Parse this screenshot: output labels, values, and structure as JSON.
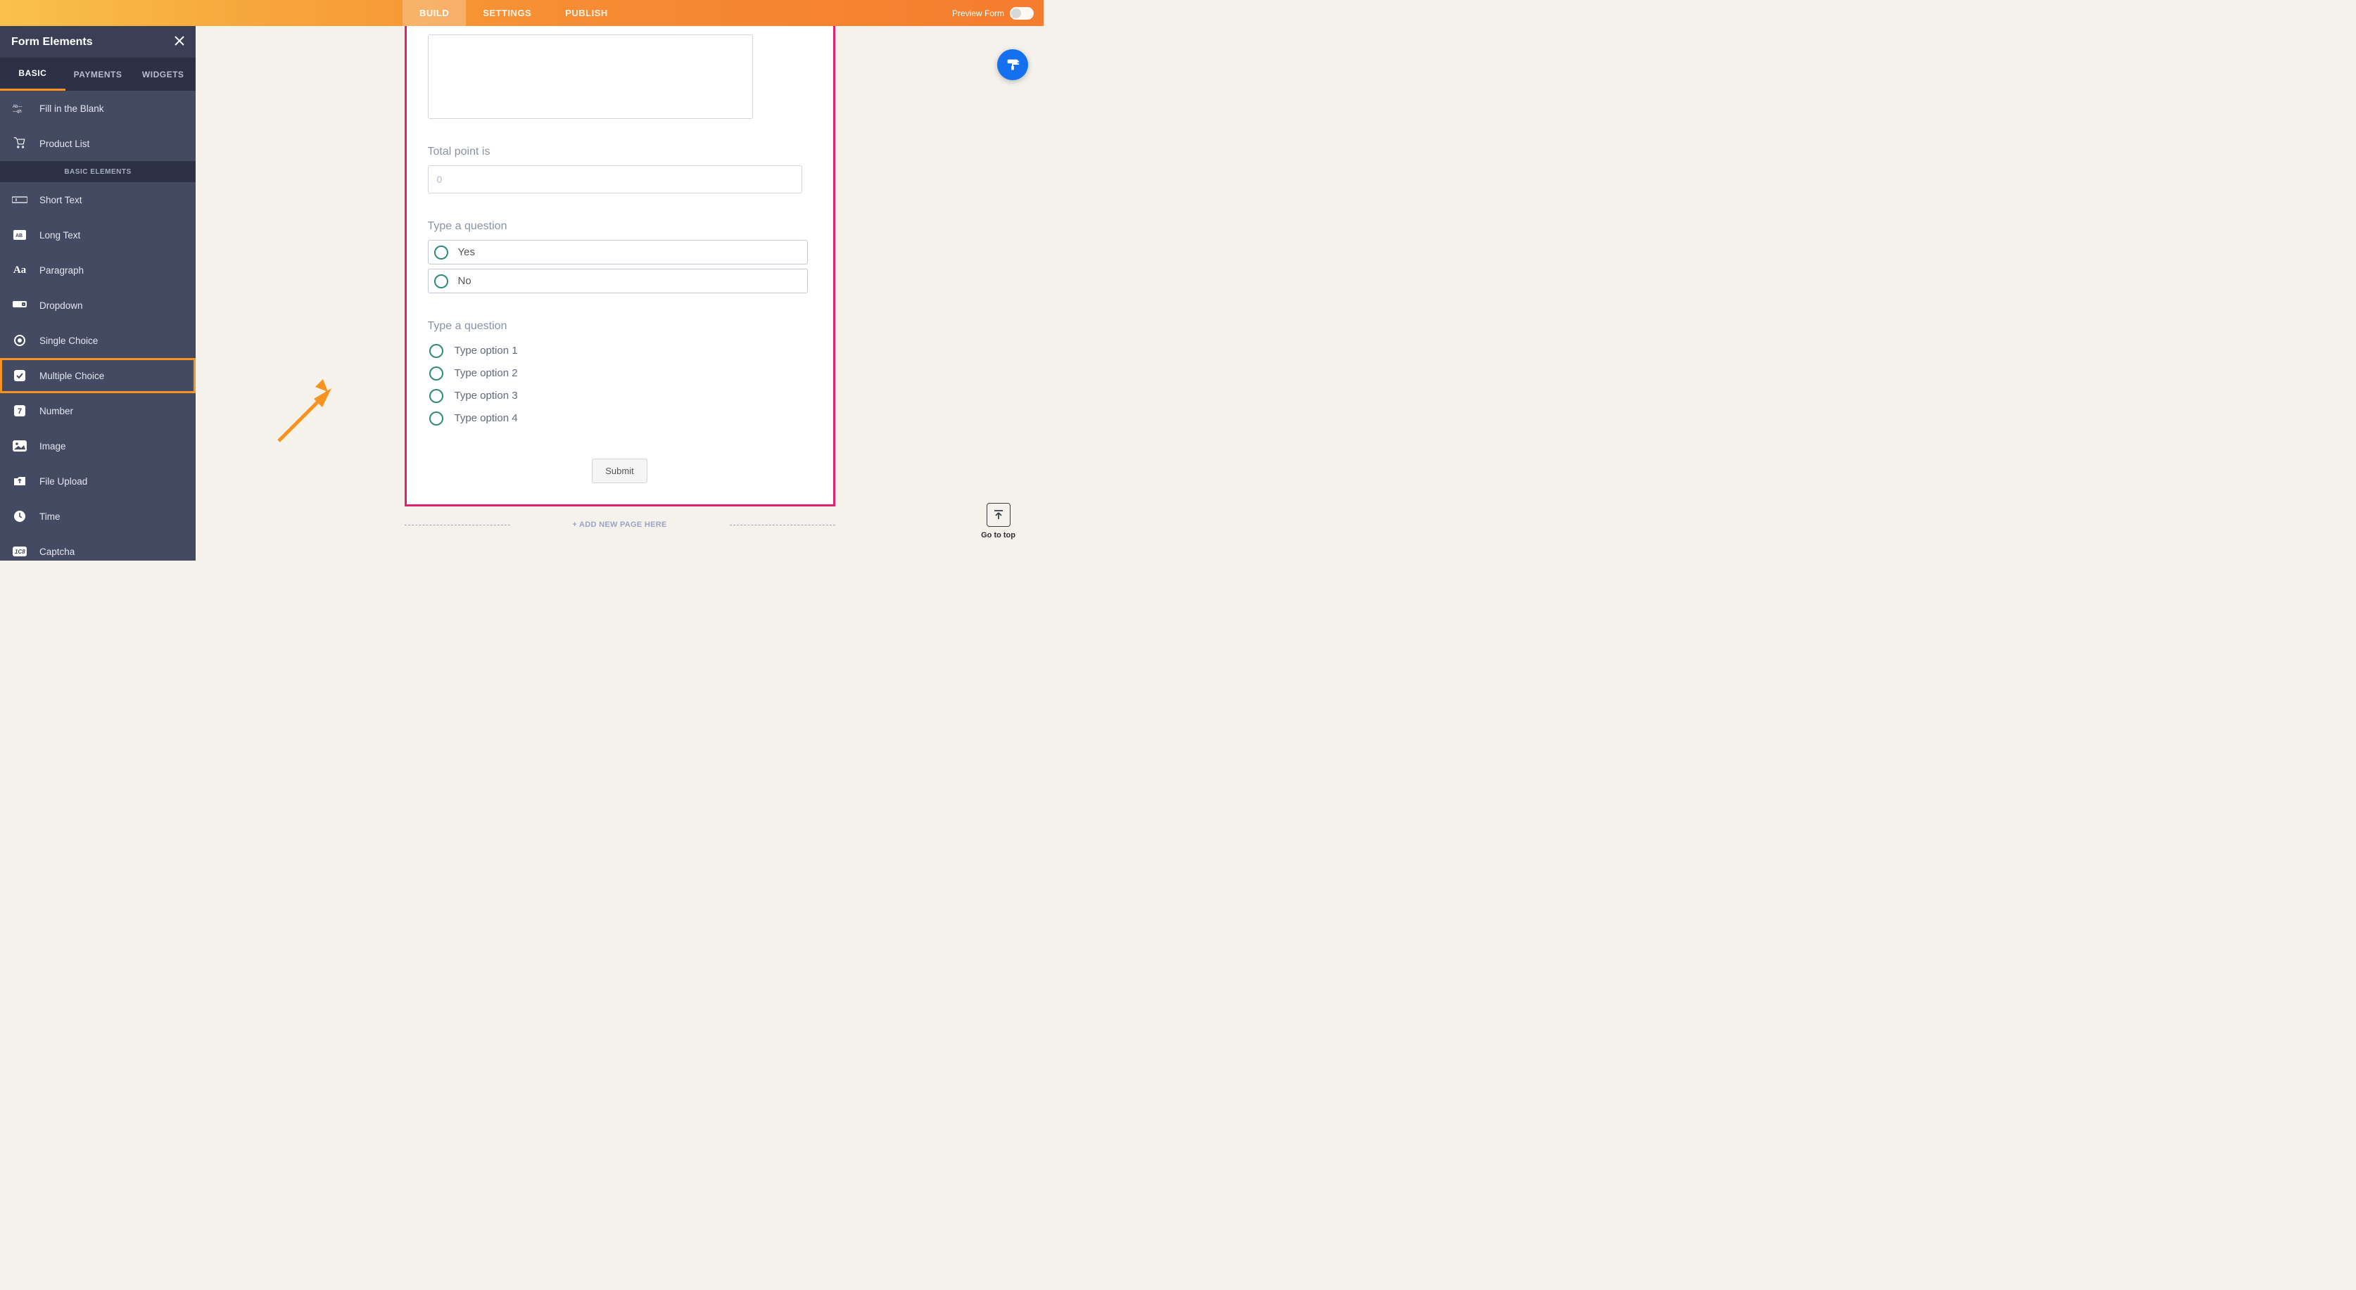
{
  "topbar": {
    "tabs": [
      "BUILD",
      "SETTINGS",
      "PUBLISH"
    ],
    "active": 0,
    "preview_label": "Preview Form"
  },
  "sidebar": {
    "title": "Form Elements",
    "tabs": [
      "BASIC",
      "PAYMENTS",
      "WIDGETS"
    ],
    "active": 0,
    "section_label": "BASIC ELEMENTS",
    "items_top": [
      {
        "label": "Fill in the Blank",
        "icon": "fill-blank"
      },
      {
        "label": "Product List",
        "icon": "cart"
      }
    ],
    "items": [
      {
        "label": "Short Text",
        "icon": "short-text"
      },
      {
        "label": "Long Text",
        "icon": "long-text"
      },
      {
        "label": "Paragraph",
        "icon": "paragraph"
      },
      {
        "label": "Dropdown",
        "icon": "dropdown"
      },
      {
        "label": "Single Choice",
        "icon": "single-choice"
      },
      {
        "label": "Multiple Choice",
        "icon": "multiple-choice",
        "highlight": true
      },
      {
        "label": "Number",
        "icon": "number"
      },
      {
        "label": "Image",
        "icon": "image"
      },
      {
        "label": "File Upload",
        "icon": "file-upload"
      },
      {
        "label": "Time",
        "icon": "time"
      },
      {
        "label": "Captcha",
        "icon": "captcha"
      }
    ]
  },
  "form": {
    "total_label": "Total point is",
    "total_placeholder": "0",
    "q1_label": "Type a question",
    "q1_options": [
      "Yes",
      "No"
    ],
    "q2_label": "Type a question",
    "q2_options": [
      "Type option 1",
      "Type option 2",
      "Type option 3",
      "Type option 4"
    ],
    "submit_label": "Submit",
    "add_page_label": "+ ADD NEW PAGE HERE"
  },
  "buttons": {
    "gototop": "Go to top"
  }
}
